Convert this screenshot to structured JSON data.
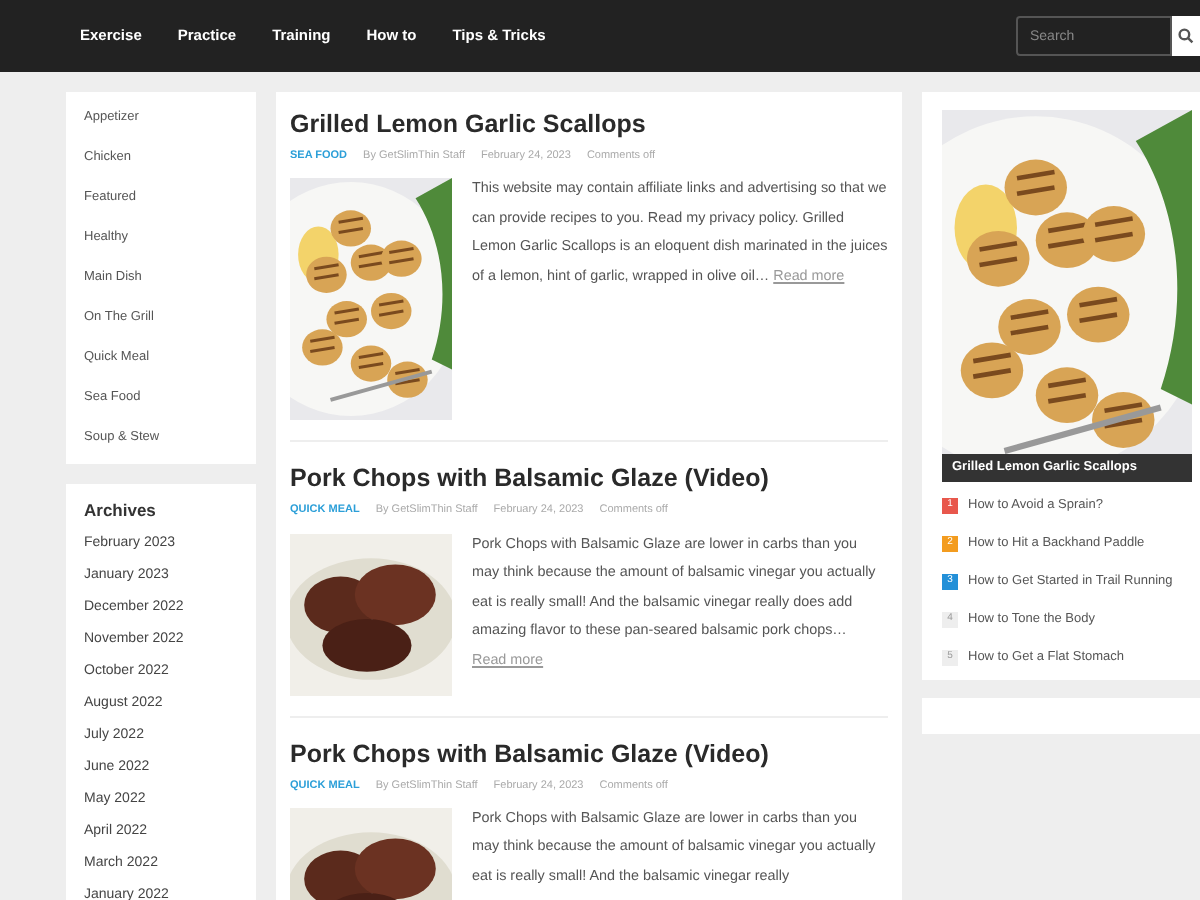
{
  "nav": {
    "items": [
      "Exercise",
      "Practice",
      "Training",
      "How to",
      "Tips & Tricks"
    ],
    "search": {
      "placeholder": "Search"
    }
  },
  "categories": [
    "Appetizer",
    "Chicken",
    "Featured",
    "Healthy",
    "Main Dish",
    "On The Grill",
    "Quick Meal",
    "Sea Food",
    "Soup & Stew"
  ],
  "archives": {
    "title": "Archives",
    "items": [
      "February 2023",
      "January 2023",
      "December 2022",
      "November 2022",
      "October 2022",
      "August 2022",
      "July 2022",
      "June 2022",
      "May 2022",
      "April 2022",
      "March 2022",
      "January 2022"
    ]
  },
  "posts": [
    {
      "title": "Grilled Lemon Garlic Scallops",
      "category": "SEA FOOD",
      "author": "By GetSlimThin Staff",
      "date": "February 24, 2023",
      "comments": "Comments off",
      "excerpt": "This website may contain affiliate links and advertising so that we can provide recipes to you. Read my privacy policy. Grilled Lemon Garlic Scallops is an eloquent dish marinated in the juices of a lemon, hint of garlic, wrapped in olive oil…",
      "read_more": "Read more"
    },
    {
      "title": "Pork Chops with Balsamic Glaze (Video)",
      "category": "QUICK MEAL",
      "author": "By GetSlimThin Staff",
      "date": "February 24, 2023",
      "comments": "Comments off",
      "excerpt": "Pork Chops with Balsamic Glaze are lower in carbs than you may think because the amount of balsamic vinegar you actually eat is really small! And the balsamic vinegar really does add amazing flavor to these pan-seared balsamic pork chops…",
      "read_more": "Read more"
    },
    {
      "title": "Pork Chops with Balsamic Glaze (Video)",
      "category": "QUICK MEAL",
      "author": "By GetSlimThin Staff",
      "date": "February 24, 2023",
      "comments": "Comments off",
      "excerpt": "Pork Chops with Balsamic Glaze are lower in carbs than you may think because the amount of balsamic vinegar you actually eat is really small! And the balsamic vinegar really"
    }
  ],
  "featured": {
    "caption": "Grilled Lemon Garlic Scallops"
  },
  "popular": [
    {
      "number": "1",
      "title": "How to Avoid a Sprain?",
      "color": "#e8574c"
    },
    {
      "number": "2",
      "title": "How to Hit a Backhand Paddle",
      "color": "#f39c1f"
    },
    {
      "number": "3",
      "title": "How to Get Started in Trail Running",
      "color": "#2390d8"
    },
    {
      "number": "4",
      "title": "How to Tone the Body",
      "color": "#eeeeee"
    },
    {
      "number": "5",
      "title": "How to Get a Flat Stomach",
      "color": "#eeeeee"
    }
  ]
}
